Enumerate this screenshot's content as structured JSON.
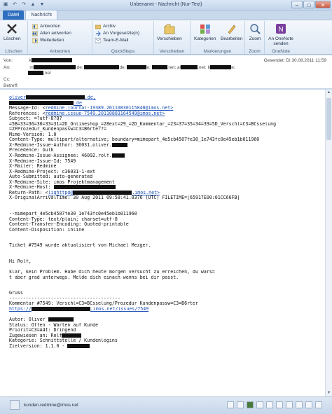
{
  "window": {
    "title": "Unbenannt - Nachricht (Nur-Text)",
    "minimize": "–",
    "maximize": "□",
    "close": "✕"
  },
  "tabs": [
    {
      "label": "Datei"
    },
    {
      "label": "Nachricht"
    }
  ],
  "ribbon": {
    "delete_group": {
      "delete_label": "Löschen",
      "group_label": "Löschen"
    },
    "respond_group": {
      "reply": "Antworten",
      "reply_all": "Allen antworten",
      "forward": "Weiterleiten",
      "group_label": "Antworten"
    },
    "quicksteps_group": {
      "archive": "Archiv",
      "to_manager": "An Vorgesetzte(n)",
      "team_email": "Team-E-Mail",
      "group_label": "QuickSteps"
    },
    "move_group": {
      "move": "Verschieben",
      "group_label": "Verschieben"
    },
    "tags_group": {
      "categorize": "Kategorien",
      "edit": "Bearbeiten",
      "group_label": "Markierungen"
    },
    "zoom_group": {
      "zoom": "Zoom",
      "group_label": "Zoom"
    },
    "onenote_group": {
      "send": "An OneNote senden",
      "group_label": "OneNote"
    }
  },
  "header": {
    "from_label": "Von:",
    "from_value": "k",
    "to_label": "An:",
    "to_items": [
      "m",
      ".de;",
      "de;",
      "e;",
      ".net;",
      "al",
      ".net;",
      "b",
      "e;"
    ],
    "to_line2": ".net",
    "cc_label": "Cc:",
    "subject_label": "Betreff:",
    "sent_label": "Gesendet:",
    "sent_value": "Di 30.08.2011 11:59"
  },
  "body": {
    "lines": [
      {
        "t": "",
        "link": "oliver",
        "tail": ".de,"
      },
      {
        "t": "",
        "link": "",
        "tail": ".de"
      },
      {
        "t": "Message-Id: <",
        "link": "redmine.journal-19389.20110830115840@imos.net",
        "tail": ">"
      },
      {
        "t": "References: <",
        "link": "redmine.issue-7549.20110803164549@imos.net",
        "tail": ">"
      },
      {
        "t": "Subject: =?utf-8?Q?"
      },
      {
        "t": "=5B=33=36=30=33=31=2D_Onlineshop_=28ext=29_=2D_Kommentar_=23=37=35=34=39=5D_Verschl=C3=BCsselung"
      },
      {
        "t": "=2FProzedur_Kundenpassw=C3=B6rter?="
      },
      {
        "t": "Mime-Version: 1.0"
      },
      {
        "t": "Content-Type: multipart/alternative; boundary=mimepart_4e5cb4507fe30_1e743fc0e45eb1b011960"
      },
      {
        "t": "X-Redmine-Issue-Author: 36031.oliver."
      },
      {
        "t": "Precedence: bulk"
      },
      {
        "t": "X-Redmine-Issue-Assignee: 46092.rolf."
      },
      {
        "t": "X-Redmine-Issue-Id: 7549"
      },
      {
        "t": "X-Mailer: Redmine"
      },
      {
        "t": "X-Redmine-Project: c36031-1-ext"
      },
      {
        "t": "Auto-Submitted: auto-generated"
      },
      {
        "t": "X-Redmine-Site: imos Projektmanagement"
      },
      {
        "t": "X-Redmine-Host: "
      },
      {
        "t": "Return-Path: <",
        "link": "lighttpd@",
        "tail": ".imos.net>"
      },
      {
        "t": "X-OriginalArrivalTime: 30 Aug 2011 09:58:41.0376 (UTC) FILETIME=[65917E00:01CC66FB]"
      },
      {
        "t": ""
      },
      {
        "t": ""
      },
      {
        "t": "--mimepart_4e5cb4507fe30_1e743fc0e45eb1b011960"
      },
      {
        "t": "Content-Type: text/plain; charset=utf-8"
      },
      {
        "t": "Content-Transfer-Encoding: Quoted-printable"
      },
      {
        "t": "Content-Disposition: inline"
      },
      {
        "t": ""
      },
      {
        "t": ""
      },
      {
        "t": "Ticket #7549 wurde aktualisiert von Michael Mezger."
      },
      {
        "t": ""
      },
      {
        "t": ""
      },
      {
        "t": "Hi Rolf,"
      },
      {
        "t": ""
      },
      {
        "t": "klar, kein Problem. Habe dich heute morgen versucht zu erreichen, du wars="
      },
      {
        "t": "t aber grad unterwegs. Melde dich einach wenns bei dir passt."
      },
      {
        "t": ""
      },
      {
        "t": ""
      },
      {
        "t": "Gruss"
      },
      {
        "t": "----------------------------------------"
      },
      {
        "t": "Kommentar #7549: Verschl=C3=BCsselung/Prozedur Kundenpassw=C3=B6rter"
      },
      {
        "t": "",
        "link": "https://",
        "tail": ".imos.net/issues/7549"
      },
      {
        "t": ""
      },
      {
        "t": "Autor: Oliver "
      },
      {
        "t": "Status: Offen - Warten auf Kunde"
      },
      {
        "t": "Priorit=C3=A4t: Dringend"
      },
      {
        "t": "Zugewiesen an: Rolf"
      },
      {
        "t": "Kategorie: Schnittstelle / Kundenlogins"
      },
      {
        "t": "Zielversion: 1.1.0 - "
      }
    ]
  },
  "people": {
    "name": "kunden.redmine@imos.net"
  },
  "colors": {
    "file_tab": "#2f6fc0",
    "link": "#1a4fb5",
    "redaction": "#111111"
  }
}
